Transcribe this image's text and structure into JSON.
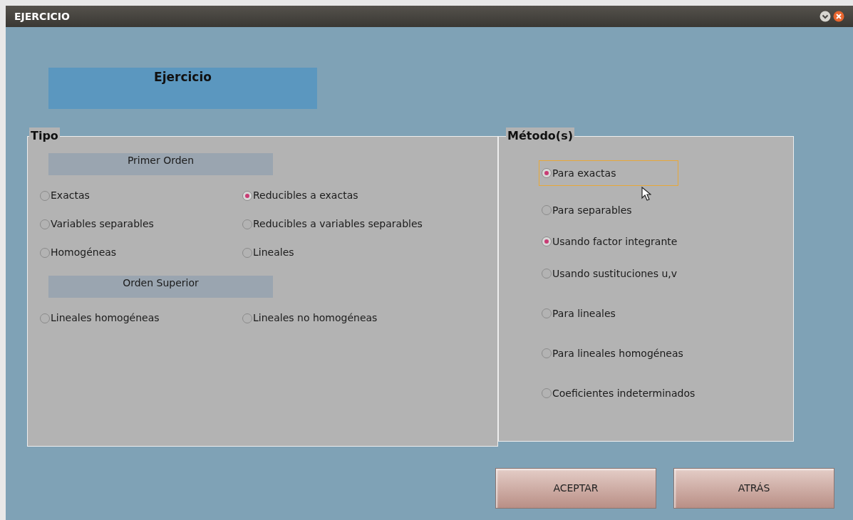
{
  "window": {
    "title": "EJERCICIO"
  },
  "header": {
    "label": "Ejercicio"
  },
  "tipo": {
    "legend": "Tipo",
    "sections": [
      {
        "heading": "Primer Orden",
        "options": [
          {
            "label": "Exactas",
            "selected": false
          },
          {
            "label": "Reducibles a exactas",
            "selected": true
          },
          {
            "label": "Variables separables",
            "selected": false
          },
          {
            "label": "Reducibles a variables separables",
            "selected": false
          },
          {
            "label": "Homogéneas",
            "selected": false
          },
          {
            "label": "Lineales",
            "selected": false
          }
        ]
      },
      {
        "heading": "Orden Superior",
        "options": [
          {
            "label": "Lineales homogéneas",
            "selected": false
          },
          {
            "label": "Lineales no homogéneas",
            "selected": false
          }
        ]
      }
    ]
  },
  "metodos": {
    "legend": "Método(s)",
    "options": [
      {
        "label": "Para exactas",
        "selected": true,
        "focused": true
      },
      {
        "label": "Para separables",
        "selected": false,
        "focused": false
      },
      {
        "label": "Usando factor integrante",
        "selected": true,
        "focused": false
      },
      {
        "label": "Usando sustituciones u,v",
        "selected": false,
        "focused": false
      },
      {
        "label": "Para lineales",
        "selected": false,
        "focused": false
      },
      {
        "label": "Para lineales homogéneas",
        "selected": false,
        "focused": false
      },
      {
        "label": "Coeficientes indeterminados",
        "selected": false,
        "focused": false
      }
    ]
  },
  "buttons": [
    {
      "label": "ACEPTAR"
    },
    {
      "label": "ATRÁS"
    }
  ]
}
